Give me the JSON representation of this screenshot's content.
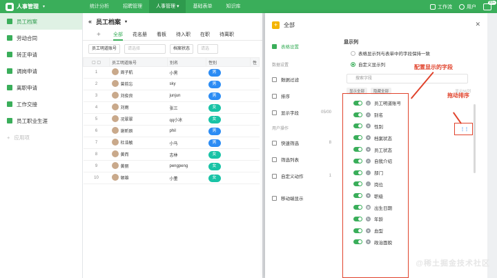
{
  "topbar": {
    "app_title": "人事管理",
    "nav": [
      "统计分析",
      "招聘管理",
      "人事管理",
      "基础表单",
      "知识库"
    ],
    "active_nav": 2,
    "workflow_label": "工作流",
    "user_label": "用户",
    "badge": "99+"
  },
  "sidebar": {
    "items": [
      {
        "label": "员工档案",
        "active": true
      },
      {
        "label": "劳动合同"
      },
      {
        "label": "转正申请"
      },
      {
        "label": "调岗申请"
      },
      {
        "label": "离职申请"
      },
      {
        "label": "工作交接"
      },
      {
        "label": "员工职业生涯"
      }
    ],
    "add_label": "应用项"
  },
  "main": {
    "title": "员工档案",
    "tabs": [
      "全部",
      "花名册",
      "看板",
      "待入职",
      "在职",
      "待离职"
    ],
    "filter1_label": "员工明道账号",
    "filter1_placeholder": "请选择",
    "filter2_label": "档案状态",
    "filter2_placeholder": "请选",
    "columns": [
      "员工明道账号",
      "别名",
      "性别",
      "性"
    ],
    "rows": [
      {
        "no": "1",
        "name": "周子航",
        "alias": "小黑",
        "gender": "男"
      },
      {
        "no": "2",
        "name": "曾前忘",
        "alias": "sky",
        "gender": "男"
      },
      {
        "no": "3",
        "name": "刘俊良",
        "alias": "junjun",
        "gender": "男"
      },
      {
        "no": "4",
        "name": "刘雨",
        "alias": "张三",
        "gender": "女"
      },
      {
        "no": "5",
        "name": "况翠翠",
        "alias": "qq小冰",
        "gender": "女"
      },
      {
        "no": "6",
        "name": "谢昕辰",
        "alias": "phil",
        "gender": "男"
      },
      {
        "no": "7",
        "name": "杜浩敏",
        "alias": "小马",
        "gender": "男"
      },
      {
        "no": "8",
        "name": "黄而",
        "alias": "志林",
        "gender": "女"
      },
      {
        "no": "9",
        "name": "黄丽",
        "alias": "pengpeng",
        "gender": "女"
      },
      {
        "no": "10",
        "name": "顿雄",
        "alias": "小董",
        "gender": "女"
      }
    ]
  },
  "panel": {
    "title": "全部",
    "left_menu": {
      "table_settings": "表格设置",
      "data_settings_section": "数据设置",
      "data_filter": "数据过滤",
      "sort": "排序",
      "show_fields": "显示字段",
      "show_fields_count": "05/00",
      "user_ops_section": "用户操作",
      "quick_filter": "快速筛选",
      "quick_filter_count": "8",
      "filter_list": "筛选列表",
      "custom_actions": "自定义动作",
      "custom_actions_count": "1",
      "mobile_display": "移动端显示"
    },
    "display_columns_title": "显示列",
    "option1": "表格显示列与表单中的字段保持一致",
    "option2": "自定义显示列",
    "search_placeholder": "搜索字段",
    "show_all": "显示全部",
    "hide_all": "隐藏全部",
    "shown_hint": "显示56列",
    "fields": [
      {
        "label": "员工明道账号",
        "icon": "user-icon"
      },
      {
        "label": "别名",
        "icon": "text-icon"
      },
      {
        "label": "性别",
        "icon": "option-icon"
      },
      {
        "label": "档案状态",
        "icon": "option-icon"
      },
      {
        "label": "员工状态",
        "icon": "option-icon"
      },
      {
        "label": "自我介绍",
        "icon": "text-icon"
      },
      {
        "label": "部门",
        "icon": "dept-icon"
      },
      {
        "label": "岗位",
        "icon": "dept-icon"
      },
      {
        "label": "职级",
        "icon": "option-icon"
      },
      {
        "label": "出生日期",
        "icon": "calendar-icon"
      },
      {
        "label": "年龄",
        "icon": "formula-icon"
      },
      {
        "label": "血型",
        "icon": "option-icon"
      },
      {
        "label": "政治面貌",
        "icon": "option-icon"
      }
    ]
  },
  "annotations": {
    "configure_label": "配置显示的字段",
    "drag_label": "拖动排序"
  },
  "watermark": "@稀土掘金技术社区",
  "colors": {
    "accent": "#3aae5a",
    "male_chip": "#2c8cf4",
    "female_chip": "#19c3a6",
    "annotation": "#e0422b"
  }
}
